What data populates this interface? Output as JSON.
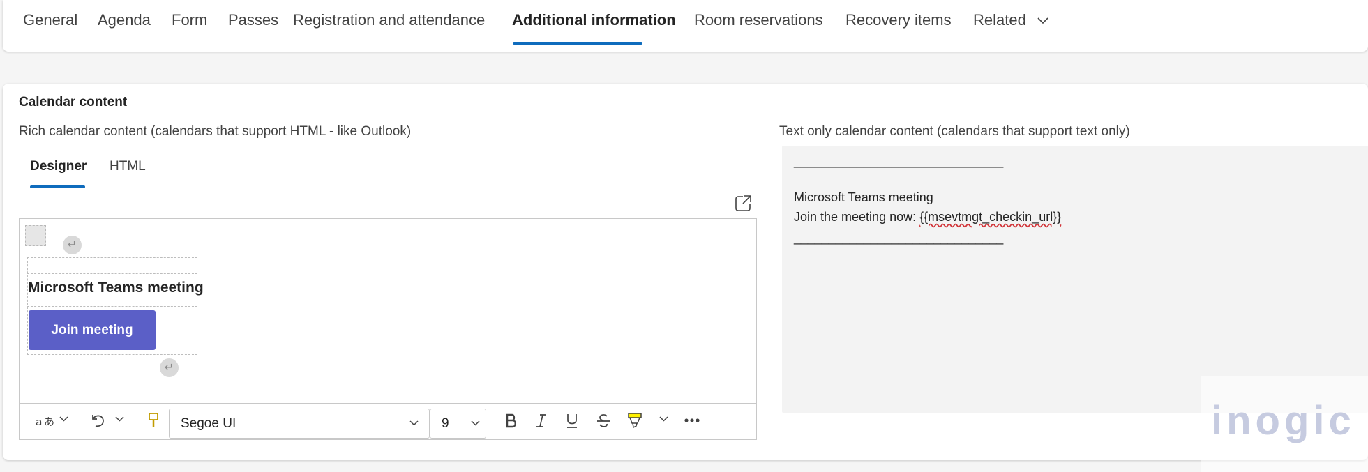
{
  "tabs": [
    {
      "label": "General"
    },
    {
      "label": "Agenda"
    },
    {
      "label": "Form"
    },
    {
      "label": "Passes"
    },
    {
      "label": "Registration and attendance"
    },
    {
      "label": "Additional information"
    },
    {
      "label": "Room reservations"
    },
    {
      "label": "Recovery items"
    },
    {
      "label": "Related"
    }
  ],
  "active_tab": "Additional information",
  "section": {
    "title": "Calendar content",
    "rich_label": "Rich calendar content (calendars that support HTML - like Outlook)",
    "text_label": "Text only calendar content (calendars that support text only)"
  },
  "editor_tabs": {
    "designer": "Designer",
    "html": "HTML",
    "active": "Designer"
  },
  "designer": {
    "meeting_title": "Microsoft Teams meeting",
    "join_button": "Join meeting"
  },
  "toolbar": {
    "font_family": "Segoe UI",
    "font_size": "9"
  },
  "text_only": {
    "rule_top": "______________________________",
    "line1": "Microsoft Teams meeting",
    "line2_prefix": "Join the meeting now: ",
    "line2_token": "{{msevtmgt_checkin_url}}",
    "rule_bottom": "______________________________"
  },
  "watermark": {
    "text": "inogic"
  },
  "colors": {
    "accent": "#0f6cbd",
    "teams_button": "#5b5fc7",
    "highlight": "#fff100",
    "format_painter": "#c19c00"
  }
}
